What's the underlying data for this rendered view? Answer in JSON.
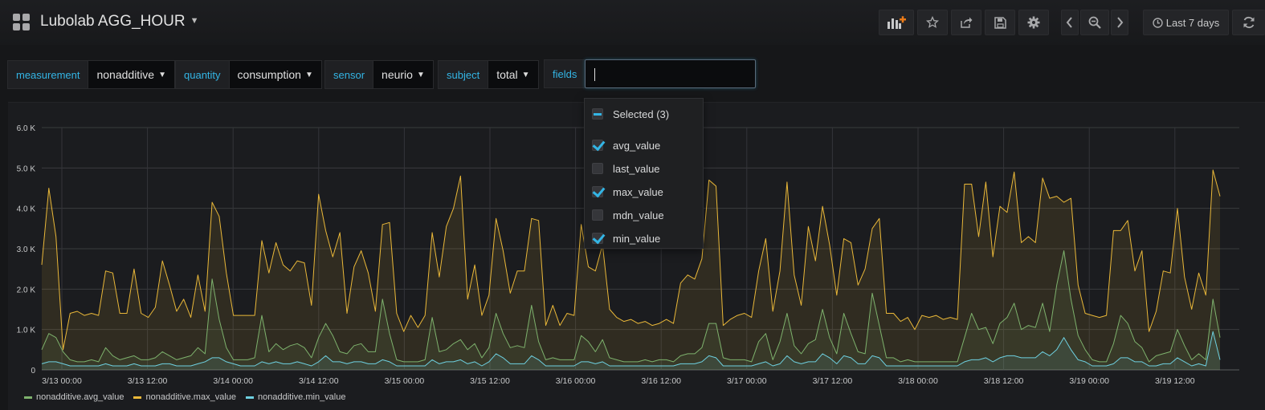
{
  "dashboard": {
    "title": "Lubolab AGG_HOUR",
    "time_range": "Last 7 days"
  },
  "toolbar": {
    "icons": [
      "add-panel-icon",
      "star-icon",
      "share-icon",
      "save-icon",
      "gear-icon",
      "chevron-left-icon",
      "zoom-out-icon",
      "chevron-right-icon",
      "clock-icon",
      "refresh-icon"
    ]
  },
  "variables": [
    {
      "label": "measurement",
      "value": "nonadditive"
    },
    {
      "label": "quantity",
      "value": "consumption"
    },
    {
      "label": "sensor",
      "value": "neurio"
    },
    {
      "label": "subject",
      "value": "total"
    }
  ],
  "fields_variable": {
    "label": "fields",
    "input_value": ""
  },
  "fields_dropdown": {
    "header": "Selected (3)",
    "options": [
      {
        "label": "avg_value",
        "checked": true
      },
      {
        "label": "last_value",
        "checked": false
      },
      {
        "label": "max_value",
        "checked": true
      },
      {
        "label": "mdn_value",
        "checked": false
      },
      {
        "label": "min_value",
        "checked": true
      }
    ]
  },
  "colors": {
    "accent": "#33b5e5",
    "avg": "#7eb26d",
    "max": "#eab839",
    "min": "#6ed0e0",
    "background": "#161719",
    "panel": "#1b1c1f"
  },
  "chart_data": {
    "type": "area",
    "x_ticks": [
      "3/13 00:00",
      "3/13 12:00",
      "3/14 00:00",
      "3/14 12:00",
      "3/15 00:00",
      "3/15 12:00",
      "3/16 00:00",
      "3/16 12:00",
      "3/17 00:00",
      "3/17 12:00",
      "3/18 00:00",
      "3/18 12:00",
      "3/19 00:00",
      "3/19 12:00"
    ],
    "y_ticks": [
      "0",
      "1.0 K",
      "2.0 K",
      "3.0 K",
      "4.0 K",
      "5.0 K",
      "6.0 K"
    ],
    "ylim": [
      0,
      6000
    ],
    "xlim_hours": [
      0,
      166
    ],
    "legend_position": "bottom-left",
    "grid": true,
    "series": [
      {
        "name": "nonadditive.max_value",
        "color": "#eab839",
        "values": [
          2600,
          4500,
          3300,
          500,
          1400,
          1450,
          1350,
          1400,
          1350,
          2450,
          2400,
          1400,
          1400,
          2500,
          1400,
          1300,
          1550,
          2700,
          2100,
          1450,
          1750,
          1300,
          2350,
          1450,
          4150,
          3800,
          2400,
          1350,
          1350,
          1350,
          1350,
          3200,
          2400,
          3150,
          2600,
          2450,
          2700,
          2650,
          1600,
          4350,
          3450,
          2800,
          3400,
          1400,
          2550,
          2950,
          2400,
          1450,
          3600,
          3650,
          1400,
          950,
          1350,
          1050,
          1350,
          3400,
          2300,
          3550,
          4000,
          4800,
          1750,
          2600,
          1350,
          1850,
          3750,
          2950,
          1900,
          2450,
          2450,
          3750,
          3700,
          1100,
          1600,
          1100,
          1400,
          1350,
          3600,
          2550,
          2450,
          3100,
          1500,
          1300,
          1200,
          1250,
          1150,
          1200,
          1100,
          1150,
          1250,
          1150,
          2150,
          2350,
          2250,
          2750,
          4700,
          4550,
          1100,
          1250,
          1350,
          1400,
          1300,
          2450,
          3250,
          1450,
          2450,
          4650,
          2350,
          1600,
          3550,
          2700,
          4050,
          3100,
          1850,
          3250,
          3150,
          2100,
          2500,
          3500,
          3750,
          1400,
          1400,
          1200,
          1300,
          1000,
          1350,
          1300,
          1350,
          1250,
          1300,
          1250,
          4600,
          4600,
          3300,
          4650,
          2800,
          4050,
          3900,
          4900,
          3150,
          3300,
          3150,
          4750,
          4250,
          4300,
          4150,
          4250,
          2100,
          1400,
          1350,
          1300,
          1350,
          3450,
          3450,
          3700,
          2450,
          2950,
          950,
          1450,
          2450,
          2400,
          4000,
          2300,
          1500,
          2400,
          1850,
          4950,
          4300
        ]
      },
      {
        "name": "nonadditive.avg_value",
        "color": "#7eb26d",
        "values": [
          500,
          900,
          800,
          450,
          250,
          200,
          200,
          250,
          200,
          550,
          350,
          250,
          300,
          350,
          250,
          250,
          300,
          450,
          350,
          250,
          300,
          350,
          550,
          400,
          2250,
          1250,
          550,
          250,
          250,
          250,
          300,
          1350,
          450,
          650,
          500,
          600,
          650,
          550,
          300,
          800,
          1150,
          850,
          450,
          400,
          600,
          650,
          450,
          450,
          1750,
          900,
          250,
          200,
          200,
          200,
          250,
          1300,
          450,
          500,
          650,
          750,
          500,
          650,
          300,
          550,
          1400,
          900,
          550,
          600,
          550,
          1600,
          700,
          250,
          300,
          250,
          250,
          250,
          850,
          700,
          450,
          750,
          300,
          250,
          200,
          200,
          200,
          250,
          200,
          250,
          250,
          200,
          350,
          400,
          400,
          550,
          1150,
          1150,
          300,
          250,
          250,
          250,
          200,
          700,
          900,
          250,
          700,
          1400,
          600,
          400,
          650,
          750,
          1500,
          800,
          400,
          1400,
          900,
          450,
          400,
          1900,
          1100,
          300,
          300,
          200,
          250,
          200,
          200,
          200,
          200,
          200,
          200,
          200,
          800,
          1400,
          1000,
          1050,
          650,
          1150,
          1300,
          1650,
          1000,
          1100,
          1050,
          1650,
          950,
          2100,
          2950,
          1750,
          850,
          500,
          250,
          200,
          200,
          650,
          1350,
          1150,
          700,
          550,
          200,
          350,
          400,
          450,
          1000,
          600,
          250,
          400,
          250,
          1750,
          800
        ]
      },
      {
        "name": "nonadditive.min_value",
        "color": "#6ed0e0",
        "values": [
          150,
          200,
          200,
          150,
          100,
          100,
          100,
          100,
          100,
          150,
          100,
          100,
          100,
          150,
          100,
          100,
          100,
          150,
          150,
          100,
          100,
          100,
          150,
          200,
          300,
          300,
          200,
          150,
          100,
          100,
          100,
          200,
          150,
          200,
          150,
          150,
          200,
          150,
          100,
          200,
          350,
          200,
          200,
          150,
          200,
          200,
          150,
          150,
          250,
          200,
          100,
          100,
          100,
          100,
          100,
          250,
          150,
          200,
          200,
          250,
          150,
          200,
          100,
          200,
          400,
          300,
          150,
          150,
          150,
          350,
          250,
          100,
          100,
          100,
          100,
          100,
          200,
          200,
          150,
          200,
          100,
          100,
          100,
          100,
          100,
          100,
          100,
          100,
          100,
          100,
          150,
          150,
          150,
          200,
          350,
          300,
          100,
          100,
          100,
          100,
          100,
          150,
          200,
          100,
          150,
          350,
          200,
          150,
          200,
          200,
          400,
          300,
          150,
          350,
          300,
          150,
          150,
          350,
          300,
          100,
          100,
          100,
          100,
          100,
          100,
          100,
          100,
          100,
          100,
          100,
          200,
          250,
          250,
          300,
          200,
          300,
          350,
          350,
          300,
          300,
          300,
          450,
          350,
          500,
          800,
          500,
          250,
          200,
          100,
          100,
          100,
          150,
          300,
          300,
          200,
          200,
          100,
          100,
          150,
          150,
          300,
          200,
          100,
          150,
          100,
          950,
          250
        ]
      }
    ]
  }
}
